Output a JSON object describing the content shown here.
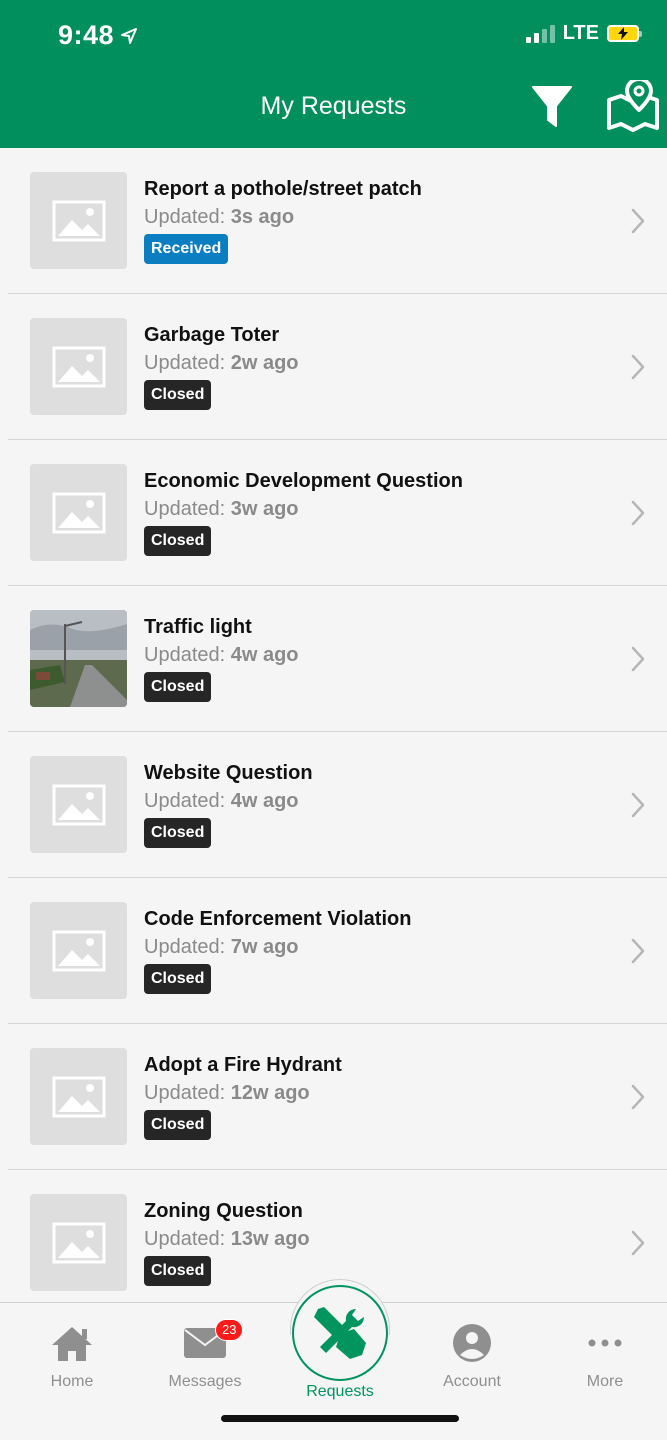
{
  "status": {
    "time": "9:48",
    "network": "LTE"
  },
  "header": {
    "title": "My Requests"
  },
  "requests": [
    {
      "title": "Report a pothole/street patch",
      "updated_prefix": "Updated: ",
      "updated_value": "3s ago",
      "status": "Received",
      "status_color": "#0b7dc1",
      "thumb": "placeholder-image-icon"
    },
    {
      "title": "Garbage Toter",
      "updated_prefix": "Updated: ",
      "updated_value": "2w ago",
      "status": "Closed",
      "status_color": "#262626",
      "thumb": "placeholder-image-icon"
    },
    {
      "title": "Economic Development Question",
      "updated_prefix": "Updated: ",
      "updated_value": "3w ago",
      "status": "Closed",
      "status_color": "#262626",
      "thumb": "placeholder-image-icon"
    },
    {
      "title": "Traffic light",
      "updated_prefix": "Updated: ",
      "updated_value": "4w ago",
      "status": "Closed",
      "status_color": "#262626",
      "thumb": "street-photo"
    },
    {
      "title": "Website Question",
      "updated_prefix": "Updated: ",
      "updated_value": "4w ago",
      "status": "Closed",
      "status_color": "#262626",
      "thumb": "placeholder-image-icon"
    },
    {
      "title": "Code Enforcement Violation",
      "updated_prefix": "Updated: ",
      "updated_value": "7w ago",
      "status": "Closed",
      "status_color": "#262626",
      "thumb": "placeholder-image-icon"
    },
    {
      "title": "Adopt a Fire Hydrant",
      "updated_prefix": "Updated: ",
      "updated_value": "12w ago",
      "status": "Closed",
      "status_color": "#262626",
      "thumb": "placeholder-image-icon"
    },
    {
      "title": "Zoning Question",
      "updated_prefix": "Updated: ",
      "updated_value": "13w ago",
      "status": "Closed",
      "status_color": "#262626",
      "thumb": "placeholder-image-icon"
    }
  ],
  "tabbar": {
    "home": "Home",
    "messages": "Messages",
    "messages_badge": "23",
    "requests": "Requests",
    "account": "Account",
    "more": "More"
  },
  "colors": {
    "brand": "#008f5d",
    "active_tab": "#00945f",
    "inactive_tab": "#8f8f8f"
  }
}
